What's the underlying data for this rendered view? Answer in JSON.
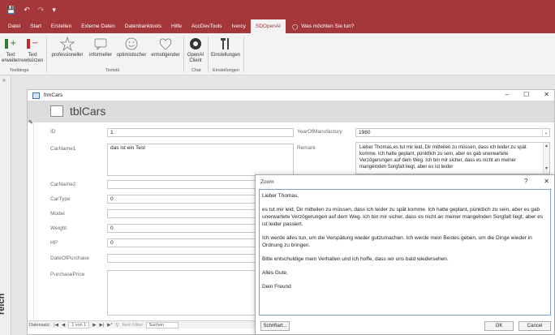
{
  "tabs": [
    "Datei",
    "Start",
    "Erstellen",
    "Externe Daten",
    "Datenbanktools",
    "Hilfe",
    "AccDevTools",
    "Ivercy",
    "SDOpenAI"
  ],
  "tell_me": "Was möchten Sie tun?",
  "ribbon": {
    "btn_extend": "Text erweitern",
    "btn_shorten": "Text verkürzen",
    "group_length": "Textlänge",
    "btn_professional": "professioneller",
    "btn_informal": "informeller",
    "btn_optimistic": "optimistischer",
    "btn_encouraging": "ermutigender",
    "group_style": "Textstil",
    "btn_client": "OpenAI Client",
    "group_chat": "Chat",
    "btn_settings": "Einstellungen",
    "group_settings": "Einstellungen"
  },
  "nav_label": "reich",
  "form": {
    "window_title": "frmCars",
    "header_title": "tblCars",
    "labels": {
      "id": "ID",
      "carname1": "CarName1",
      "carname2": "CarName2",
      "cartype": "CarType",
      "model": "Model",
      "weight": "Weight",
      "hp": "HP",
      "dateofpurchase": "DateOfPurchase",
      "purchaseprice": "PurchasePrice",
      "year": "YearOfManufactury",
      "remark": "Remark"
    },
    "values": {
      "id": "1",
      "carname1": "das ist ein Test",
      "cartype": "0",
      "weight": "0",
      "hp": "0",
      "year": "1980"
    },
    "remark_text": "Lieber Thomas,es tut mir leid, Dir mitteilen zu müssen, dass ich leider zu spät komme. Ich hatte geplant, pünktlich zu sein, aber es gab unerwartete Verzögerungen auf dem Weg. Ich bin mir sicher, dass es nicht an meiner mangelnden Sorgfalt liegt, aber es ist leider"
  },
  "recnav": {
    "label": "Datensatz:",
    "position": "1 von 1",
    "filter": "Kein Filter",
    "search": "Suchen"
  },
  "zoom": {
    "title": "Zoom",
    "help": "?",
    "close": "✕",
    "paragraphs": [
      "Lieber Thomas,",
      "es tut mir leid, Dir mitteilen zu müssen, dass ich leider zu spät komme. Ich hatte geplant, pünktlich zu sein, aber es gab unerwartete Verzögerungen auf dem Weg. Ich bin mir sicher, dass es nicht an meiner mangelnden Sorgfalt liegt, aber es ist leider passiert.",
      "Ich werde alles tun, um die Verspätung wieder gutzumachen. Ich werde mein Bestes geben, um die Dinge wieder in Ordnung zu bringen.",
      "Bitte entschuldige mein Verhalten und ich hoffe, dass wir uns bald wiedersehen.",
      "Alles Gute,",
      "Dein Freund"
    ],
    "font_button": "Schriftart...",
    "ok_button": "OK",
    "cancel_button": "Cancel"
  },
  "colors": {
    "accent": "#a4373a"
  }
}
